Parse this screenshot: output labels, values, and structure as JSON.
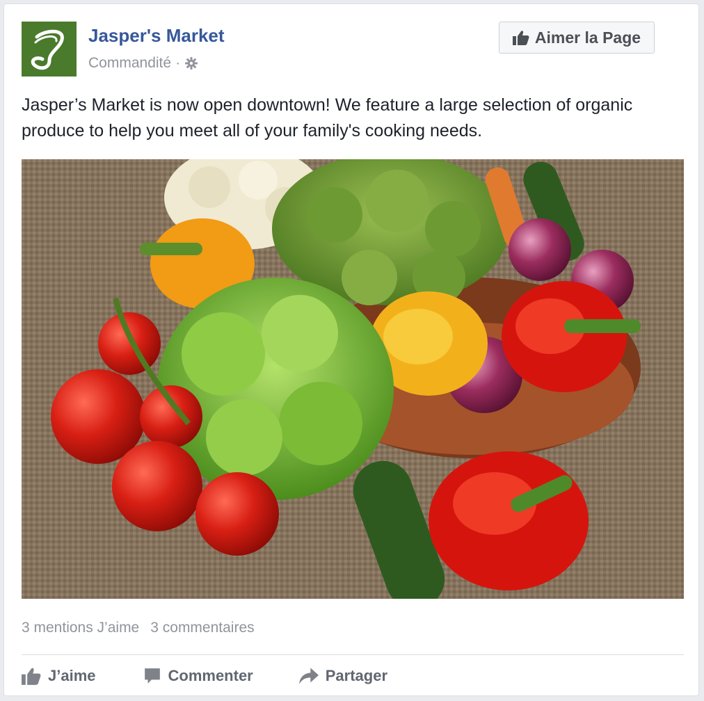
{
  "post": {
    "page_name": "Jasper's Market",
    "sponsored_label": "Commandité",
    "separator": "·",
    "like_page_label": "Aimer la Page",
    "text": "Jasper’s Market is now open downtown! We feature a large selection of organic produce to help you meet all of your family's cooking needs.",
    "image_icon": "vegetables-photo",
    "logo_icon": "jaspers-market-logo"
  },
  "stats": {
    "likes": "3 mentions J’aime",
    "comments": "3 commentaires"
  },
  "actions": {
    "like_label": "J’aime",
    "comment_label": "Commenter",
    "share_label": "Partager"
  },
  "colors": {
    "brand_blue": "#365899",
    "logo_green": "#4a7a2c",
    "muted_text": "#90949c",
    "action_text": "#606770"
  }
}
